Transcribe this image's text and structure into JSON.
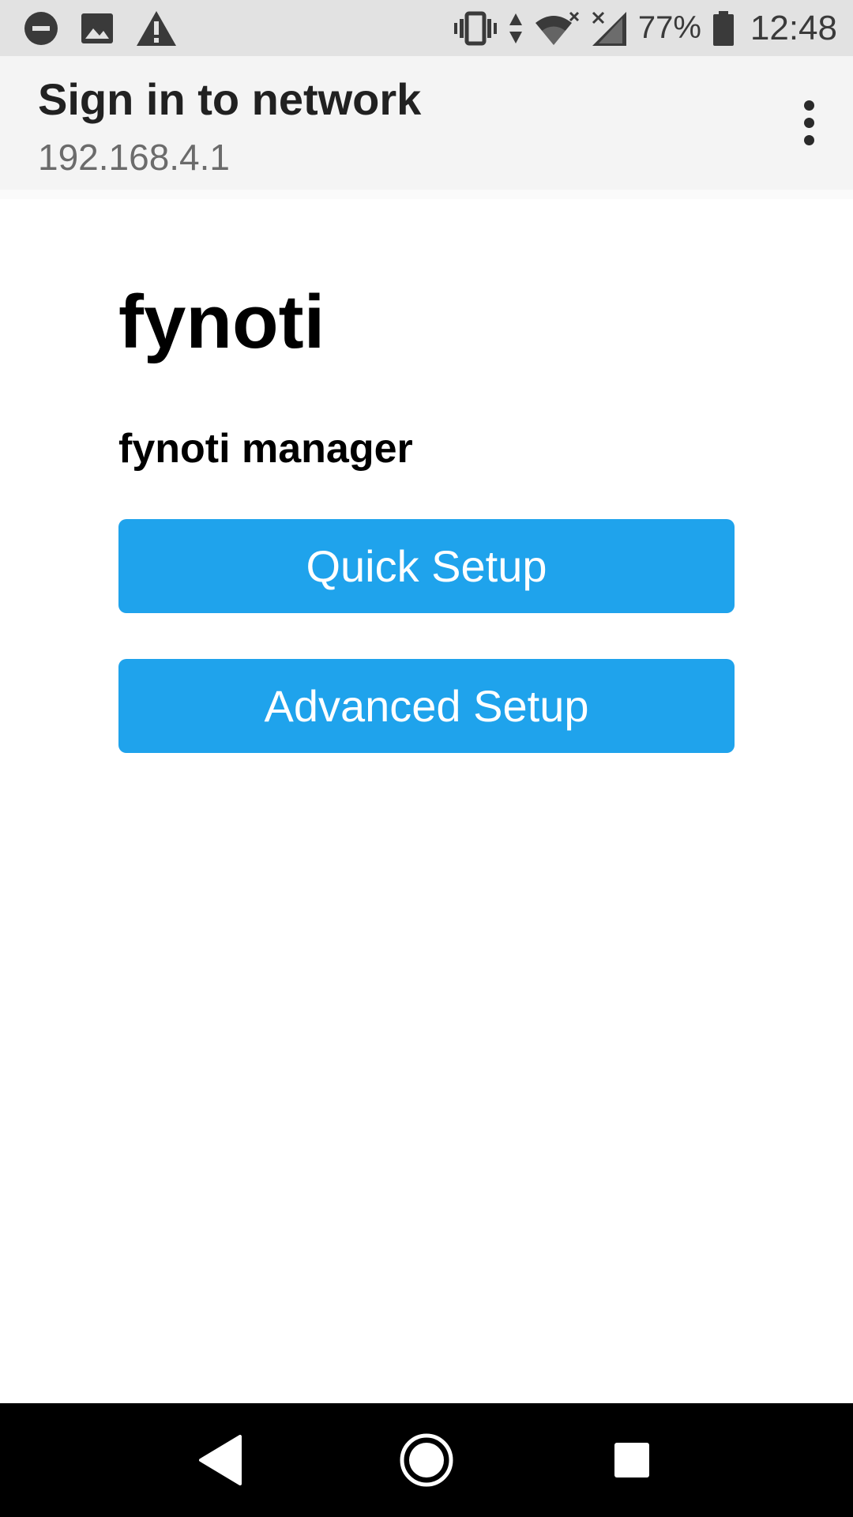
{
  "status_bar": {
    "battery_text": "77%",
    "time": "12:48",
    "icons": [
      "do-not-disturb-icon",
      "image-icon",
      "warning-icon",
      "vibrate-icon",
      "data-arrows-icon",
      "wifi-no-internet-icon",
      "signal-no-service-icon",
      "battery-icon"
    ]
  },
  "app_bar": {
    "title": "Sign in to network",
    "subtitle": "192.168.4.1",
    "menu_icon": "more-vert-icon"
  },
  "page": {
    "heading": "fynoti",
    "subheading": "fynoti manager",
    "quick_setup_label": "Quick Setup",
    "advanced_setup_label": "Advanced Setup"
  },
  "nav_bar": {
    "icons": [
      "back-icon",
      "home-icon",
      "recents-icon"
    ]
  },
  "colors": {
    "status_bar": "#e2e2e2",
    "app_bar": "#f4f4f4",
    "button": "#1fa3ec",
    "nav_bar": "#000000"
  }
}
